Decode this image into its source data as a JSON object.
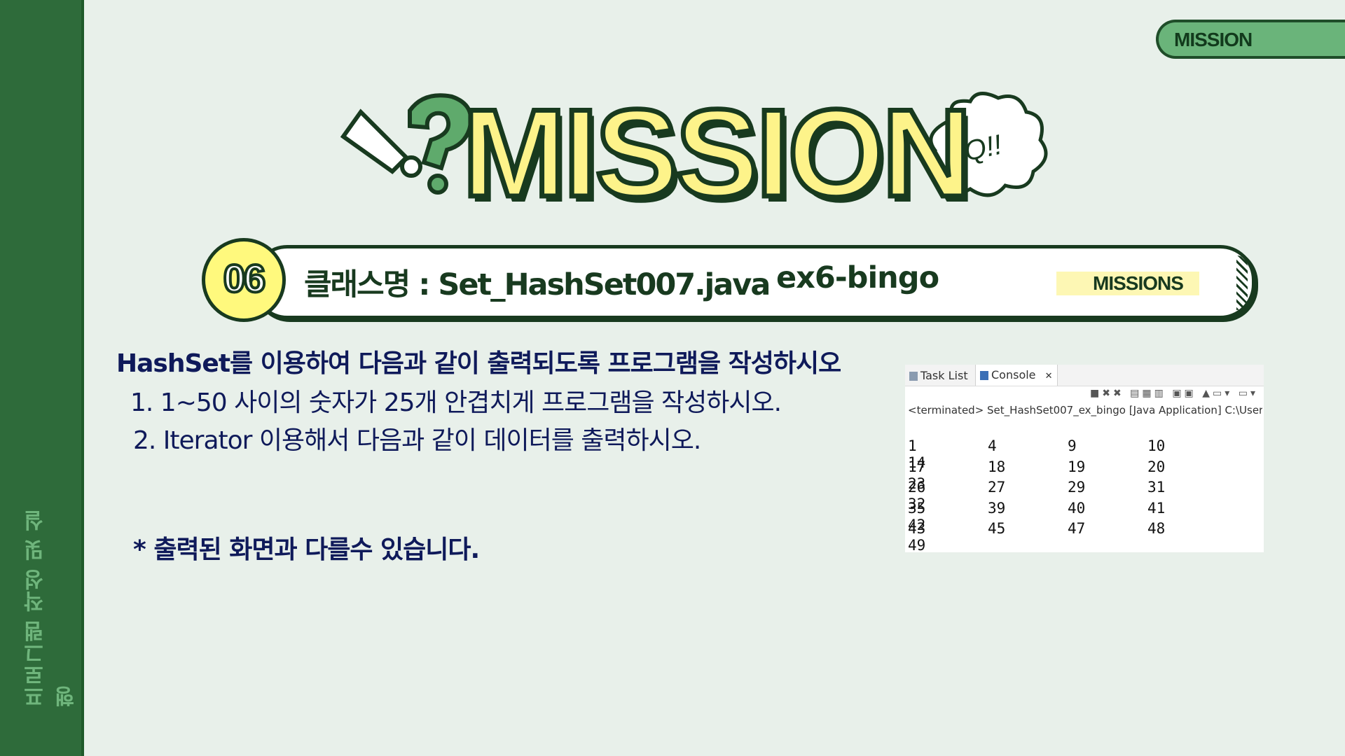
{
  "sidebar": {
    "label": "프로그램 작성 및 실행"
  },
  "top_tag": {
    "label": "MISSION"
  },
  "banner": {
    "title": "MISSION",
    "bubble": "Q!!"
  },
  "mission_bar": {
    "number": "06",
    "class_label": "클래스명 : Set_HashSet007.java",
    "project": "ex6-bingo",
    "pill": "MISSIONS"
  },
  "instructions": {
    "heading": "HashSet를 이용하여 다음과 같이 출력되도록 프로그램을 작성하시오",
    "item1": "1. 1~50 사이의 숫자가  25개 안겹치게 프로그램을 작성하시오.",
    "item2": "2.  Iterator  이용해서 다음과 같이 데이터를 출력하시오.",
    "note": "*  출력된 화면과 다를수 있습니다."
  },
  "console": {
    "tabs": [
      {
        "label": "Task List"
      },
      {
        "label": "Console"
      }
    ],
    "close_glyph": "✕",
    "terminated": "<terminated> Set_HashSet007_ex_bingo [Java Application] C:\\Users\\",
    "rows": [
      [
        "1",
        "4",
        "9",
        "10",
        "14"
      ],
      [
        "17",
        "18",
        "19",
        "20",
        "23"
      ],
      [
        "26",
        "27",
        "29",
        "31",
        "32"
      ],
      [
        "35",
        "39",
        "40",
        "41",
        "42"
      ],
      [
        "43",
        "45",
        "47",
        "48",
        "49"
      ]
    ]
  },
  "colors": {
    "sidebar": "#2e6b3a",
    "background": "#e8f0ea",
    "accent_yellow": "#fdf38a",
    "dark_green": "#183a1f",
    "instruction_text": "#0f1a5a"
  }
}
